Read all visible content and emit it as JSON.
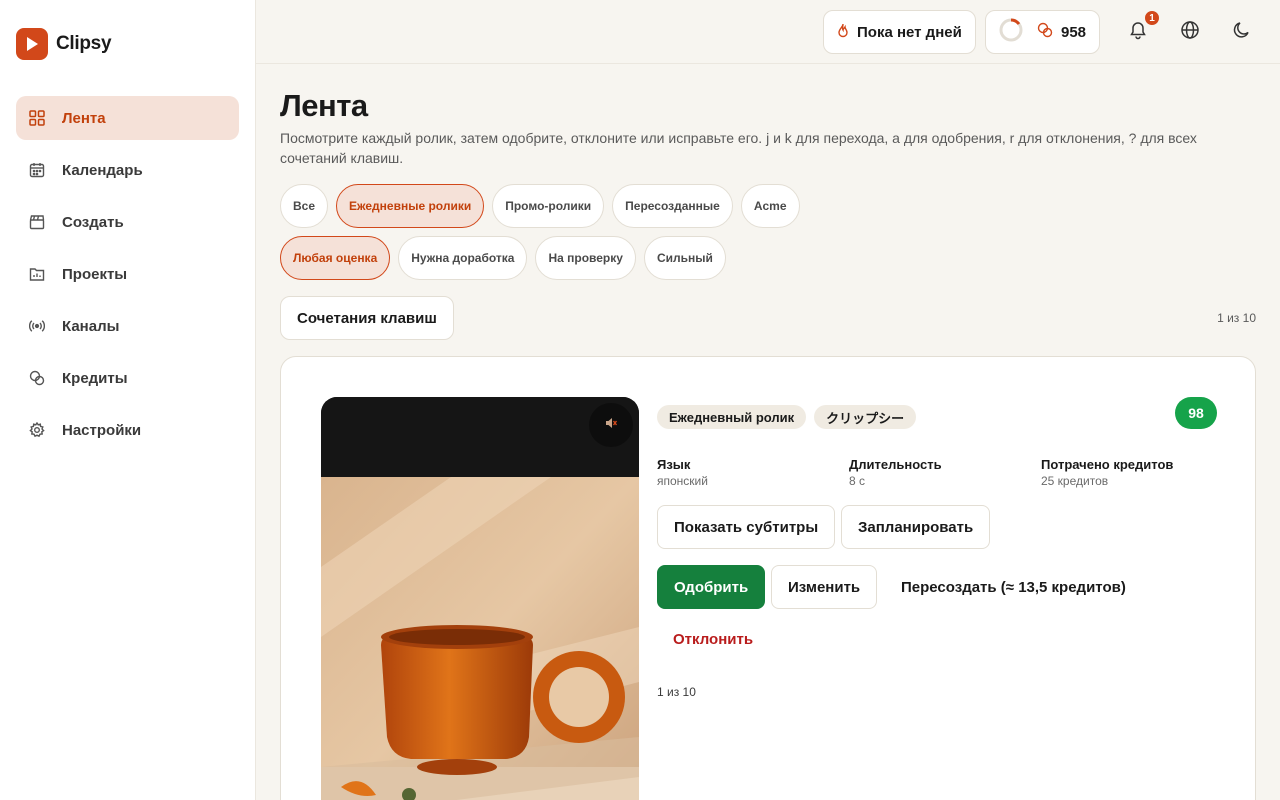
{
  "brand": {
    "name": "Clipsy",
    "accent": "#d2481a"
  },
  "sidebar": {
    "items": [
      {
        "label": "Лента",
        "icon": "grid-icon",
        "active": true
      },
      {
        "label": "Календарь",
        "icon": "calendar-icon",
        "active": false
      },
      {
        "label": "Создать",
        "icon": "clapperboard-icon",
        "active": false
      },
      {
        "label": "Проекты",
        "icon": "folder-icon",
        "active": false
      },
      {
        "label": "Каналы",
        "icon": "broadcast-icon",
        "active": false
      },
      {
        "label": "Кредиты",
        "icon": "coins-icon",
        "active": false
      },
      {
        "label": "Настройки",
        "icon": "gear-icon",
        "active": false
      }
    ]
  },
  "topbar": {
    "streak_label": "Пока нет дней",
    "credits_value": "958",
    "notifications_count": "1"
  },
  "page": {
    "title": "Лента",
    "description": "Посмотрите каждый ролик, затем одобрите, отклоните или исправьте его. j и k для перехода, a для одобрения, r для отклонения, ? для всех сочетаний клавиш."
  },
  "filters": {
    "type": [
      "Все",
      "Ежедневные ролики",
      "Промо-ролики",
      "Пересозданные",
      "Acme"
    ],
    "type_active": 1,
    "rating": [
      "Любая оценка",
      "Нужна доработка",
      "На проверку",
      "Сильный"
    ],
    "rating_active": 0
  },
  "shortcuts_label": "Сочетания клавиш",
  "position_label": "1 из 10",
  "card": {
    "tags": [
      "Ежедневный ролик",
      "クリップシー"
    ],
    "score": "98",
    "meta": {
      "language_label": "Язык",
      "language_value": "японский",
      "duration_label": "Длительность",
      "duration_value": "8 с",
      "credits_label": "Потрачено кредитов",
      "credits_value": "25 кредитов"
    },
    "show_subtitles": "Показать субтитры",
    "schedule": "Запланировать",
    "approve": "Одобрить",
    "edit": "Изменить",
    "recreate": "Пересоздать (≈ 13,5 кредитов)",
    "reject": "Отклонить",
    "position": "1 из 10"
  }
}
